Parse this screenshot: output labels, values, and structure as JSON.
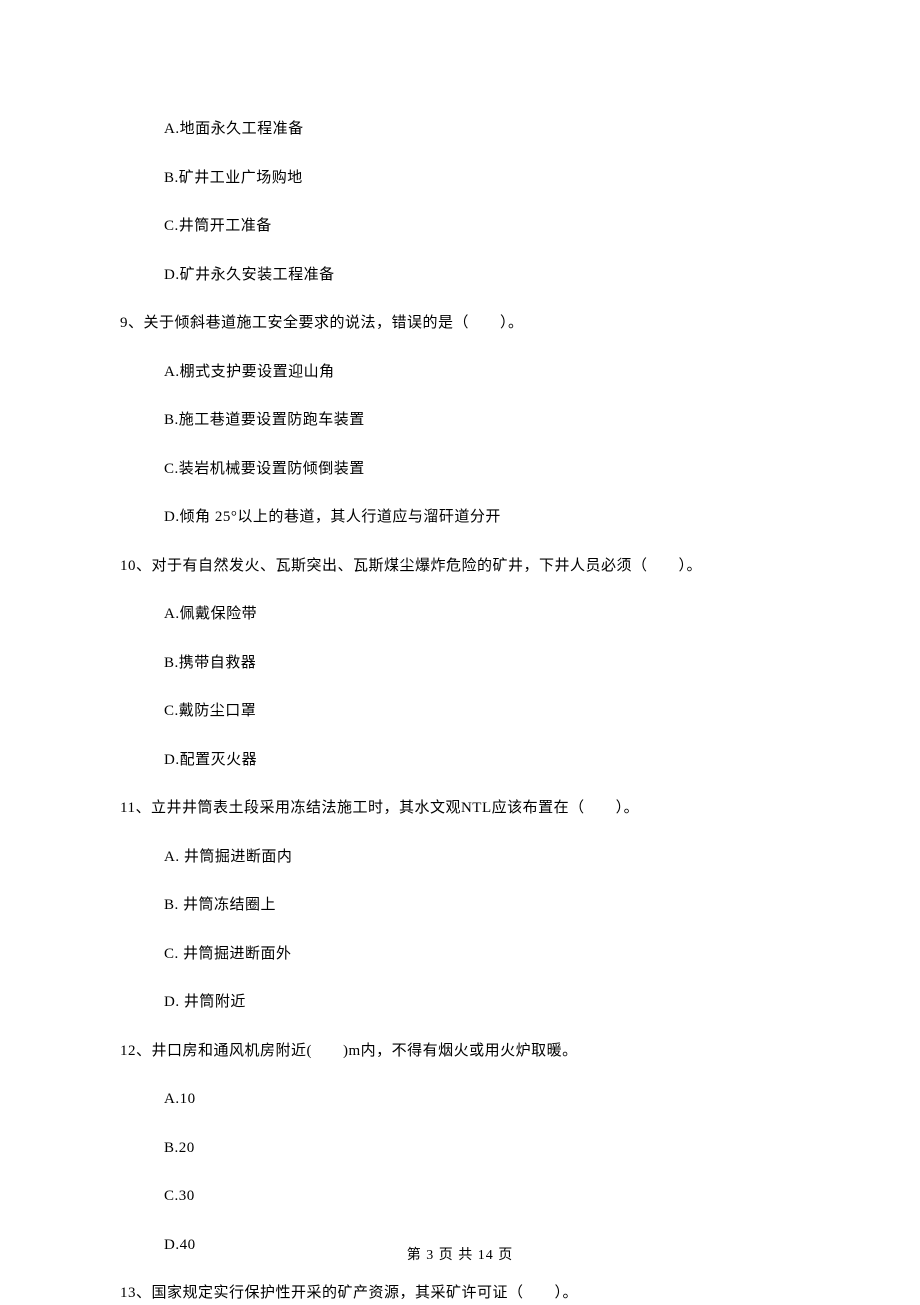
{
  "q8_options": {
    "a": "A.地面永久工程准备",
    "b": "B.矿井工业广场购地",
    "c": "C.井筒开工准备",
    "d": "D.矿井永久安装工程准备"
  },
  "q9": {
    "stem": "9、关于倾斜巷道施工安全要求的说法，错误的是（　　）。",
    "a": "A.棚式支护要设置迎山角",
    "b": "B.施工巷道要设置防跑车装置",
    "c": "C.装岩机械要设置防倾倒装置",
    "d": "D.倾角 25°以上的巷道，其人行道应与溜矸道分开"
  },
  "q10": {
    "stem": "10、对于有自然发火、瓦斯突出、瓦斯煤尘爆炸危险的矿井，下井人员必须（　　）。",
    "a": "A.佩戴保险带",
    "b": "B.携带自救器",
    "c": "C.戴防尘口罩",
    "d": "D.配置灭火器"
  },
  "q11": {
    "stem": "11、立井井筒表土段采用冻结法施工时，其水文观NTL应该布置在（　　）。",
    "a": "A. 井筒掘进断面内",
    "b": "B. 井筒冻结圈上",
    "c": "C. 井筒掘进断面外",
    "d": "D. 井筒附近"
  },
  "q12": {
    "stem": "12、井口房和通风机房附近(　　)m内，不得有烟火或用火炉取暖。",
    "a": "A.10",
    "b": "B.20",
    "c": "C.30",
    "d": "D.40"
  },
  "q13": {
    "stem": "13、国家规定实行保护性开采的矿产资源，其采矿许可证（　　）。"
  },
  "footer": "第 3 页 共 14 页"
}
